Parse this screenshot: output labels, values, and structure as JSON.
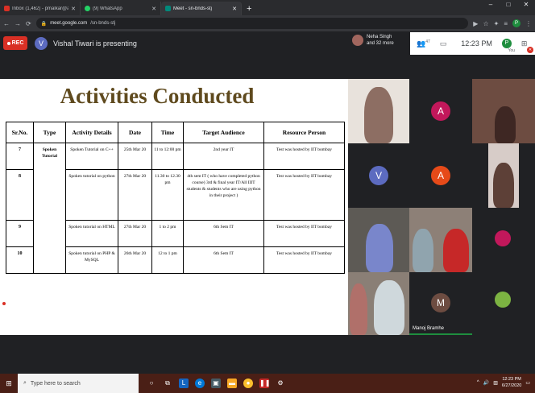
{
  "browser": {
    "tabs": [
      {
        "label": "Inbox (1,462) - pmalkar@atharvacoe",
        "color": "#d93025",
        "active": false
      },
      {
        "label": "(9) WhatsApp",
        "color": "#25d366",
        "active": false
      },
      {
        "label": "Meet - sn-bnds-stj",
        "color": "#00897b",
        "active": true
      }
    ],
    "new_tab": "+",
    "url_host": "meet.google.com",
    "url_path": "/sn-bnds-stj",
    "profile_initial": "P"
  },
  "meet": {
    "rec_label": "REC",
    "presenter_initial": "V",
    "presenting_text": "Vishal Tiwari is presenting",
    "participants_name": "Neha Singh",
    "participants_more": "and 32 more",
    "participant_count": "47",
    "clock": "12:23 PM",
    "self_initial": "P",
    "self_label": "You",
    "tiles": [
      {
        "initial": "A",
        "color": "#c2185b"
      },
      {
        "initial": "V",
        "color": "#5c6bc0"
      },
      {
        "initial": "A",
        "color": "#e64a19"
      },
      {
        "initial": "M",
        "color": "#6d4c41",
        "name": "Manoj Bramhe"
      }
    ]
  },
  "slide": {
    "title": "Activities Conducted",
    "headers": [
      "Sr.No.",
      "Type",
      "Activity Details",
      "Date",
      "Time",
      "Target Audience",
      "Resource Person"
    ],
    "type_label": "Spoken Tutorial",
    "rows": [
      {
        "sr": "7",
        "details": "Spoken Tutorial on C++",
        "date": "25th Mar 20",
        "time": "11 to 12:00 pm",
        "audience": "2nd year IT",
        "resource": "Test was hosted by IIT bombay"
      },
      {
        "sr": "8",
        "details": "Spoken tutorial on python",
        "date": "27th Mar 20",
        "time": "11.30 to 12.30 pm",
        "audience": "4th sem IT ( who have completed python course) 3rd & final year IT/All IIIT students & students who are using python in their project )",
        "resource": "Test was hosted by IIT bombay"
      },
      {
        "sr": "9",
        "details": "Spoken tutorial on HTML",
        "date": "27th Mar 20",
        "time": "1 to 2 pm",
        "audience": "6th Sem IT",
        "resource": "Test was hosted by IIT bombay"
      },
      {
        "sr": "10",
        "details": "Spoken tutorial on PHP & MySQL",
        "date": "26th Mar 20",
        "time": "12 to 1 pm",
        "audience": "6th Sem IT",
        "resource": "Test was hosted by IIT bombay"
      }
    ]
  },
  "taskbar": {
    "search_placeholder": "Type here to search",
    "tray_time": "12:23 PM",
    "tray_date": "6/27/2020"
  }
}
